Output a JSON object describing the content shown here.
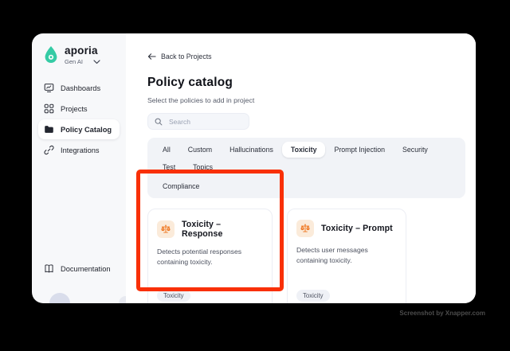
{
  "app": {
    "name": "aporia",
    "workspace": "Gen AI"
  },
  "sidebar": {
    "items": [
      {
        "label": "Dashboards",
        "icon": "dashboard-icon",
        "active": false
      },
      {
        "label": "Projects",
        "icon": "grid-icon",
        "active": false
      },
      {
        "label": "Policy Catalog",
        "icon": "folder-icon",
        "active": true
      },
      {
        "label": "Integrations",
        "icon": "link-icon",
        "active": false
      }
    ],
    "footer_item": {
      "label": "Documentation",
      "icon": "book-icon"
    }
  },
  "header": {
    "back_label": "Back to Projects",
    "title": "Policy catalog",
    "subtitle": "Select the policies to add in project",
    "search_placeholder": "Search"
  },
  "filters": {
    "tabs": [
      "All",
      "Custom",
      "Hallucinations",
      "Toxicity",
      "Prompt Injection",
      "Security",
      "Test",
      "Topics",
      "Compliance"
    ],
    "selected": "Toxicity"
  },
  "cards": [
    {
      "title": "Toxicity – Response",
      "description": "Detects potential responses containing toxicity.",
      "tag": "Toxicity",
      "icon": "scales-icon",
      "highlighted": true
    },
    {
      "title": "Toxicity – Prompt",
      "description": "Detects user messages containing toxicity.",
      "tag": "Toxicity",
      "icon": "scales-icon",
      "highlighted": false
    }
  ],
  "annotation": {
    "type": "highlight-box",
    "color": "#F93007"
  },
  "watermark": "Screenshot by Xnapper.com",
  "colors": {
    "brand_teal": "#35CBA5",
    "icon_orange": "#EE731B",
    "icon_orange_bg": "#FBEBDA",
    "annotation_red": "#F93007",
    "sidebar_bg": "#F7F8FA",
    "tabs_bg": "#F1F3F7"
  }
}
